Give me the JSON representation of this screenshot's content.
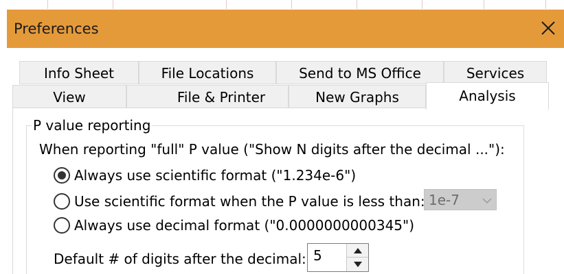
{
  "window": {
    "title": "Preferences"
  },
  "tabs": {
    "row1": [
      "Info Sheet",
      "File Locations",
      "Send to MS Office",
      "Services"
    ],
    "row2": [
      "View",
      "File & Printer",
      "New Graphs",
      "Analysis"
    ],
    "active": "Analysis"
  },
  "pvalue": {
    "group_label": "P value reporting",
    "instruction": "When reporting \"full\" P value (\"Show N digits after the decimal ...\"):",
    "options": [
      {
        "label": "Always use scientific format (\"1.234e-6\")",
        "selected": true
      },
      {
        "label": "Use scientific format when the P value is less than:",
        "selected": false
      },
      {
        "label": "Always use decimal format (\"0.0000000000345\")",
        "selected": false
      }
    ],
    "threshold_value": "1e-7",
    "digits_label": "Default # of digits after the decimal:",
    "digits_value": "5"
  },
  "colors": {
    "titlebar": "#e59a3a",
    "tab_inactive": "#f0f0f0",
    "combo_disabled": "#cccccc"
  },
  "icons": {
    "close": "close-icon",
    "chevron": "chevron-down-icon",
    "spin_up": "arrow-up-icon",
    "spin_down": "arrow-down-icon"
  }
}
